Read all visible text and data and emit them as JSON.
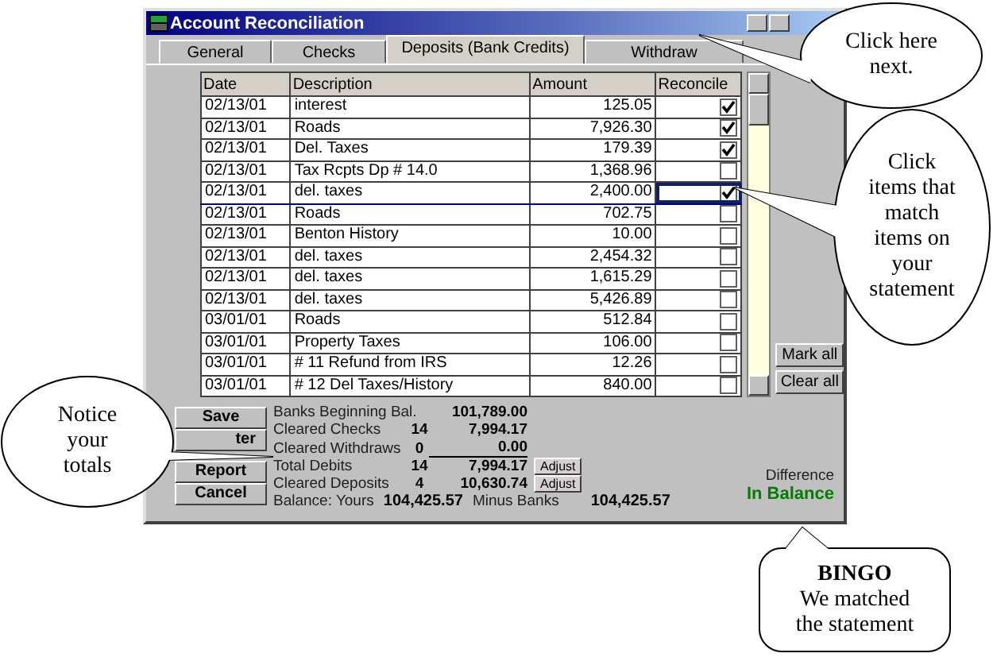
{
  "window": {
    "title": "Account Reconciliation"
  },
  "tabs": [
    {
      "label": "General",
      "selected": false
    },
    {
      "label": "Checks",
      "selected": false
    },
    {
      "label": "Deposits (Bank Credits)",
      "selected": true
    },
    {
      "label": "Withdraw",
      "selected": false
    }
  ],
  "table": {
    "columns": [
      "Date",
      "Description",
      "Amount",
      "Reconcile"
    ],
    "rows": [
      {
        "date": "02/13/01",
        "description": "interest",
        "amount": "125.05",
        "reconciled": true,
        "selected": false
      },
      {
        "date": "02/13/01",
        "description": "Roads",
        "amount": "7,926.30",
        "reconciled": true,
        "selected": false
      },
      {
        "date": "02/13/01",
        "description": "Del. Taxes",
        "amount": "179.39",
        "reconciled": true,
        "selected": false
      },
      {
        "date": "02/13/01",
        "description": "Tax Rcpts Dp # 14.0",
        "amount": "1,368.96",
        "reconciled": false,
        "selected": false
      },
      {
        "date": "02/13/01",
        "description": "del. taxes",
        "amount": "2,400.00",
        "reconciled": true,
        "selected": true
      },
      {
        "date": "02/13/01",
        "description": "Roads",
        "amount": "702.75",
        "reconciled": false,
        "selected": false
      },
      {
        "date": "02/13/01",
        "description": "Benton History",
        "amount": "10.00",
        "reconciled": false,
        "selected": false
      },
      {
        "date": "02/13/01",
        "description": "del. taxes",
        "amount": "2,454.32",
        "reconciled": false,
        "selected": false
      },
      {
        "date": "02/13/01",
        "description": "del. taxes",
        "amount": "1,615.29",
        "reconciled": false,
        "selected": false
      },
      {
        "date": "02/13/01",
        "description": "del. taxes",
        "amount": "5,426.89",
        "reconciled": false,
        "selected": false
      },
      {
        "date": "03/01/01",
        "description": "Roads",
        "amount": "512.84",
        "reconciled": false,
        "selected": false
      },
      {
        "date": "03/01/01",
        "description": "Property Taxes",
        "amount": "106.00",
        "reconciled": false,
        "selected": false
      },
      {
        "date": "03/01/01",
        "description": "# 11 Refund from IRS",
        "amount": "12.26",
        "reconciled": false,
        "selected": false
      },
      {
        "date": "03/01/01",
        "description": "# 12 Del Taxes/History",
        "amount": "840.00",
        "reconciled": false,
        "selected": false
      }
    ]
  },
  "side_buttons": [
    "Mark all",
    "Clear all"
  ],
  "action_buttons": [
    "Save",
    "ter",
    "Report",
    "Cancel"
  ],
  "summary": [
    {
      "label": "Banks Beginning Bal.",
      "amount": "101,789.00"
    },
    {
      "label": "Cleared Checks",
      "count": "14",
      "amount": "7,994.17"
    },
    {
      "label": "Cleared Withdraws",
      "count": "0",
      "amount": "0.00"
    },
    {
      "label": "Total Debits",
      "count": "14",
      "amount": "7,994.17",
      "action": "Adjust"
    },
    {
      "label": "Cleared Deposits",
      "count": "4",
      "amount": "10,630.74",
      "action": "Adjust"
    }
  ],
  "balance": {
    "label": "Balance: Yours",
    "yours": "104,425.57",
    "banks_label": "Minus Banks",
    "banks": "104,425.57"
  },
  "difference": {
    "label": "Difference",
    "status": "In Balance"
  },
  "callouts": [
    {
      "kind": "ellipse",
      "lines": [
        "Click here",
        "next."
      ]
    },
    {
      "kind": "ellipse",
      "lines": [
        "Click",
        "items that",
        "match",
        "items on",
        "your",
        "statement"
      ]
    },
    {
      "kind": "ellipse",
      "lines": [
        "Notice",
        "your",
        "totals"
      ]
    },
    {
      "kind": "box",
      "lines": [
        "**BINGO**",
        "We matched",
        "the statement"
      ]
    }
  ]
}
